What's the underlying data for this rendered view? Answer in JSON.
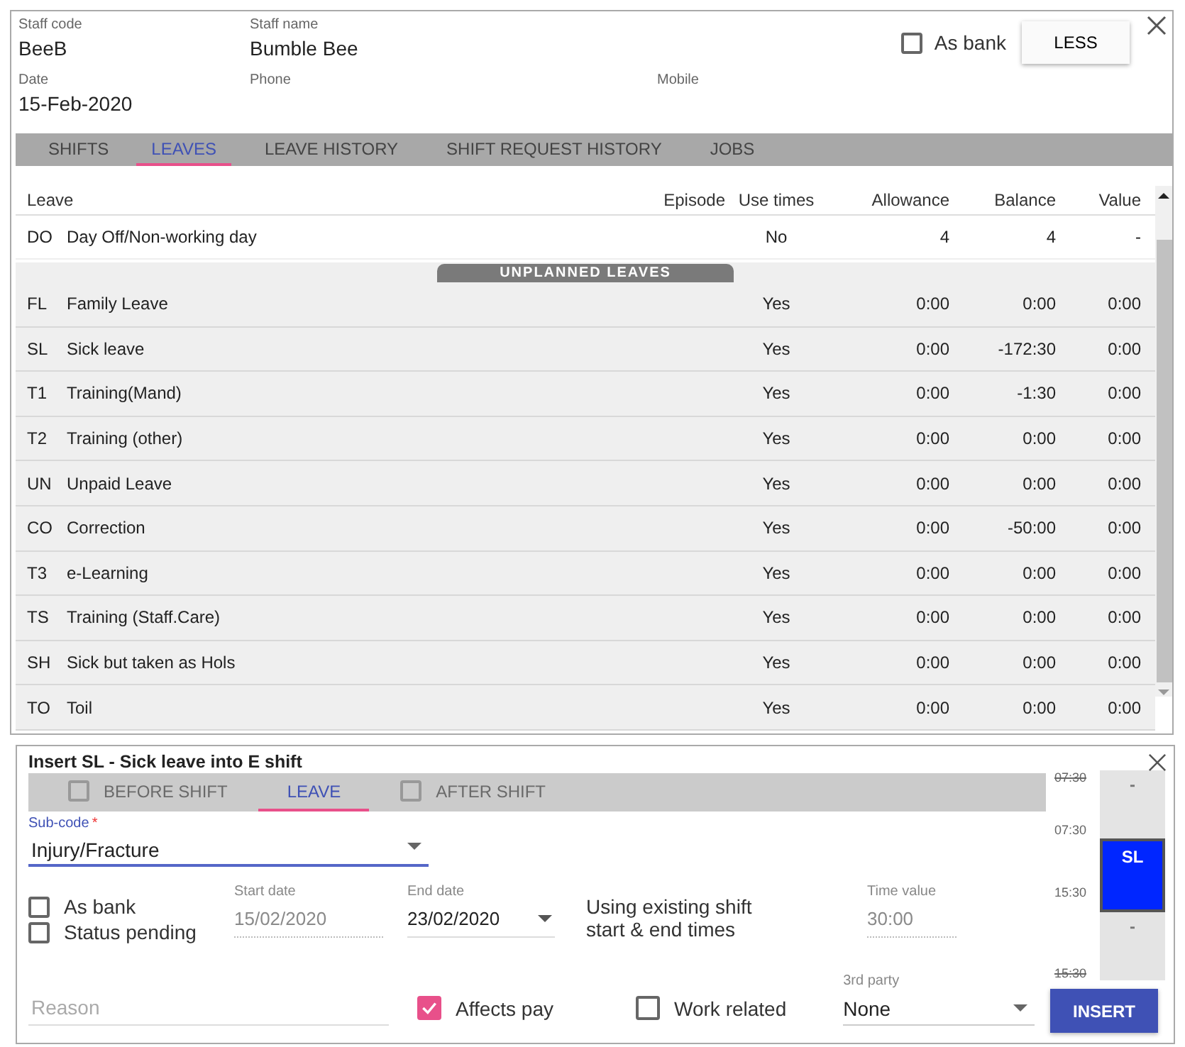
{
  "staff": {
    "fields": [
      {
        "label": "Staff code",
        "value": "BeeB"
      },
      {
        "label": "Staff name",
        "value": "Bumble Bee"
      },
      {
        "label": "Date",
        "value": "15-Feb-2020"
      },
      {
        "label": "Phone"
      },
      {
        "label": "Mobile"
      }
    ],
    "as_bank": {
      "label": "As bank",
      "checked": false
    },
    "less_button": "LESS"
  },
  "tabs": [
    {
      "label": "SHIFTS",
      "selected": false
    },
    {
      "label": "LEAVES",
      "selected": true
    },
    {
      "label": "LEAVE HISTORY",
      "selected": false
    },
    {
      "label": "SHIFT REQUEST HISTORY",
      "selected": false
    },
    {
      "label": "JOBS",
      "selected": false
    }
  ],
  "table": {
    "columns": [
      "Leave",
      "Episode",
      "Use times",
      "Allowance",
      "Balance",
      "Value"
    ],
    "planned_rows": [
      {
        "code": "DO",
        "name": "Day Off/Non-working day",
        "use_times": "No",
        "allowance": "4",
        "balance": "4",
        "value": "-"
      }
    ],
    "group_label": "UNPLANNED LEAVES",
    "unplanned_rows": [
      {
        "code": "FL",
        "name": "Family Leave",
        "use_times": "Yes",
        "allowance": "0:00",
        "balance": "0:00",
        "value": "0:00"
      },
      {
        "code": "SL",
        "name": "Sick leave",
        "use_times": "Yes",
        "allowance": "0:00",
        "balance": "-172:30",
        "value": "0:00"
      },
      {
        "code": "T1",
        "name": "Training(Mand)",
        "use_times": "Yes",
        "allowance": "0:00",
        "balance": "-1:30",
        "value": "0:00"
      },
      {
        "code": "T2",
        "name": "Training (other)",
        "use_times": "Yes",
        "allowance": "0:00",
        "balance": "0:00",
        "value": "0:00"
      },
      {
        "code": "UN",
        "name": "Unpaid Leave",
        "use_times": "Yes",
        "allowance": "0:00",
        "balance": "0:00",
        "value": "0:00"
      },
      {
        "code": "CO",
        "name": "Correction",
        "use_times": "Yes",
        "allowance": "0:00",
        "balance": "-50:00",
        "value": "0:00"
      },
      {
        "code": "T3",
        "name": "e-Learning",
        "use_times": "Yes",
        "allowance": "0:00",
        "balance": "0:00",
        "value": "0:00"
      },
      {
        "code": "TS",
        "name": "Training (Staff.Care)",
        "use_times": "Yes",
        "allowance": "0:00",
        "balance": "0:00",
        "value": "0:00"
      },
      {
        "code": "SH",
        "name": "Sick but taken as Hols",
        "use_times": "Yes",
        "allowance": "0:00",
        "balance": "0:00",
        "value": "0:00"
      },
      {
        "code": "TO",
        "name": "Toil",
        "use_times": "Yes",
        "allowance": "0:00",
        "balance": "0:00",
        "value": "0:00"
      }
    ]
  },
  "insert_panel": {
    "title": "Insert SL - Sick leave into E shift",
    "tabs": [
      {
        "label": "BEFORE SHIFT",
        "kind": "checkbox",
        "selected": false,
        "disabled": true
      },
      {
        "label": "LEAVE",
        "kind": "plain",
        "selected": true,
        "disabled": false
      },
      {
        "label": "AFTER SHIFT",
        "kind": "checkbox",
        "selected": false,
        "disabled": true
      }
    ],
    "sub_code": {
      "label": "Sub-code",
      "required_mark": "*",
      "value": "Injury/Fracture"
    },
    "options": [
      {
        "label": "As bank",
        "checked": false
      },
      {
        "label": "Status pending",
        "checked": false
      }
    ],
    "start_date": {
      "label": "Start date",
      "value": "15/02/2020",
      "disabled": true
    },
    "end_date": {
      "label": "End date",
      "value": "23/02/2020",
      "disabled": false
    },
    "note": "Using existing shift start & end times",
    "time_value": {
      "label": "Time value",
      "value": "30:00",
      "disabled": true
    },
    "reason": {
      "placeholder": "Reason"
    },
    "affects_pay": {
      "label": "Affects pay",
      "checked": true
    },
    "work_related": {
      "label": "Work related",
      "checked": false
    },
    "third_party": {
      "label": "3rd party",
      "value": "None"
    },
    "insert_button": "INSERT",
    "timeline": {
      "times": [
        {
          "label": "07:30",
          "struck": true
        },
        {
          "label": "07:30",
          "struck": false
        },
        {
          "label": "15:30",
          "struck": false
        },
        {
          "label": "15:30",
          "struck": true
        }
      ],
      "segments": [
        {
          "label": "-",
          "selected": false
        },
        {
          "label": "SL",
          "selected": true
        },
        {
          "label": "-",
          "selected": false
        }
      ]
    }
  }
}
